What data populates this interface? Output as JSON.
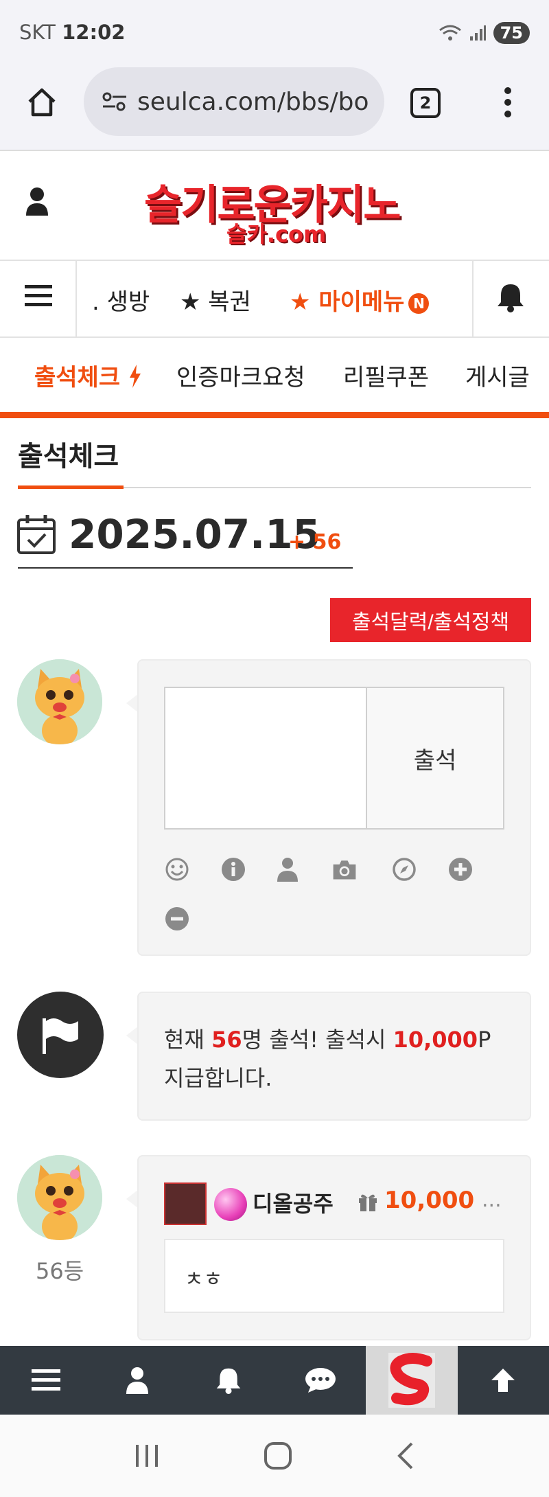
{
  "status_bar": {
    "carrier": "SKT",
    "time": "12:02",
    "battery": "75"
  },
  "browser": {
    "url": "seulca.com/bbs/bo",
    "tab_count": "2"
  },
  "site": {
    "logo_main": "슬기로운카지노",
    "logo_sub": "슬카.com"
  },
  "nav": {
    "items": [
      ". 생방",
      "★ 복권",
      "★ 마이메뉴"
    ],
    "badge": "N"
  },
  "subtabs": [
    "출석체크",
    "인증마크요청",
    "리필쿠폰",
    "게시글"
  ],
  "page": {
    "title": "출석체크",
    "date": "2025.07.15",
    "date_plus": "+ 56",
    "policy_button": "출석달력/출석정책"
  },
  "attend_form": {
    "submit_label": "출석"
  },
  "notice": {
    "prefix": "현재 ",
    "count": "56",
    "mid": "명 출석! 출석시 ",
    "points": "10,000",
    "suffix": "P",
    "line2": "지급합니다."
  },
  "entry": {
    "rank": "56등",
    "nickname": "디올공주",
    "points": "10,000",
    "more": "...",
    "comment": "ㅊㅎ"
  },
  "colors": {
    "accent": "#f04e10",
    "brand_red": "#e8252b",
    "bottom_nav": "#333a41"
  }
}
